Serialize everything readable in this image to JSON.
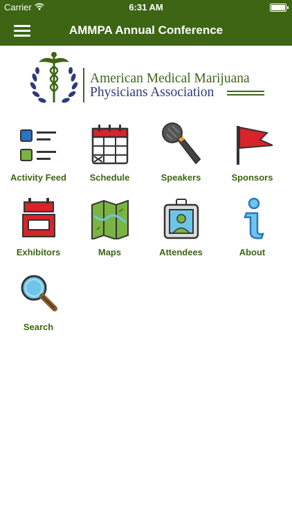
{
  "status_bar": {
    "carrier": "Carrier",
    "time": "6:31 AM"
  },
  "nav": {
    "title": "AMMPA Annual Conference"
  },
  "logo": {
    "line1": "American Medical Marijuana",
    "line2": "Physicians Association"
  },
  "tiles": [
    {
      "label": "Activity Feed",
      "icon": "activity-feed-icon"
    },
    {
      "label": "Schedule",
      "icon": "calendar-icon"
    },
    {
      "label": "Speakers",
      "icon": "microphone-icon"
    },
    {
      "label": "Sponsors",
      "icon": "flag-icon"
    },
    {
      "label": "Exhibitors",
      "icon": "booth-icon"
    },
    {
      "label": "Maps",
      "icon": "map-icon"
    },
    {
      "label": "Attendees",
      "icon": "badge-icon"
    },
    {
      "label": "About",
      "icon": "info-icon"
    },
    {
      "label": "Search",
      "icon": "magnifier-icon"
    }
  ],
  "colors": {
    "nav_bg": "#3d6514",
    "label": "#3d6514",
    "red": "#d8232a",
    "blue": "#2b74bf"
  }
}
